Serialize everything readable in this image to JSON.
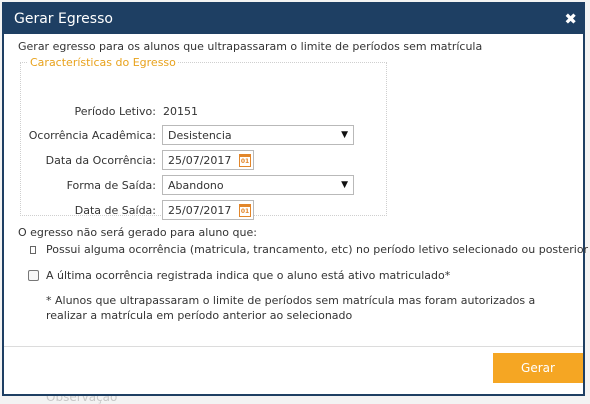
{
  "dialog": {
    "title": "Gerar Egresso",
    "close_glyph": "✖",
    "intro": "Gerar egresso para os alunos que ultrapassaram o limite de períodos sem matrícula"
  },
  "characteristics": {
    "legend": "Características do Egresso",
    "periodo_label": "Período Letivo:",
    "periodo_value": "20151",
    "ocorrencia_label": "Ocorrência Acadêmica:",
    "ocorrencia_value": "Desistencia",
    "data_ocorrencia_label": "Data da Ocorrência:",
    "data_ocorrencia_value": "25/07/2017",
    "forma_saida_label": "Forma de Saída:",
    "forma_saida_value": "Abandono",
    "data_saida_label": "Data de Saída:",
    "data_saida_value": "25/07/2017",
    "calendar_icon_text": "01"
  },
  "conditions": {
    "lead": "O egresso não será gerado para aluno que:",
    "item1": "Possui alguma ocorrência (matricula, trancamento, etc) no período letivo selecionado ou posterior",
    "item2": "A última ocorrência registrada indica que o aluno está ativo matriculado*",
    "item2_checked": false,
    "note": "* Alunos que ultrapassaram o limite de períodos sem matrícula mas foram autorizados a realizar a matrícula em período anterior ao selecionado"
  },
  "footer": {
    "gerar_label": "Gerar"
  },
  "background": {
    "partial_text": "Observação"
  },
  "colors": {
    "titlebar": "#1e3f63",
    "legend": "#e8a21c",
    "calendar": "#e2862a",
    "primary_button": "#f5a623"
  }
}
